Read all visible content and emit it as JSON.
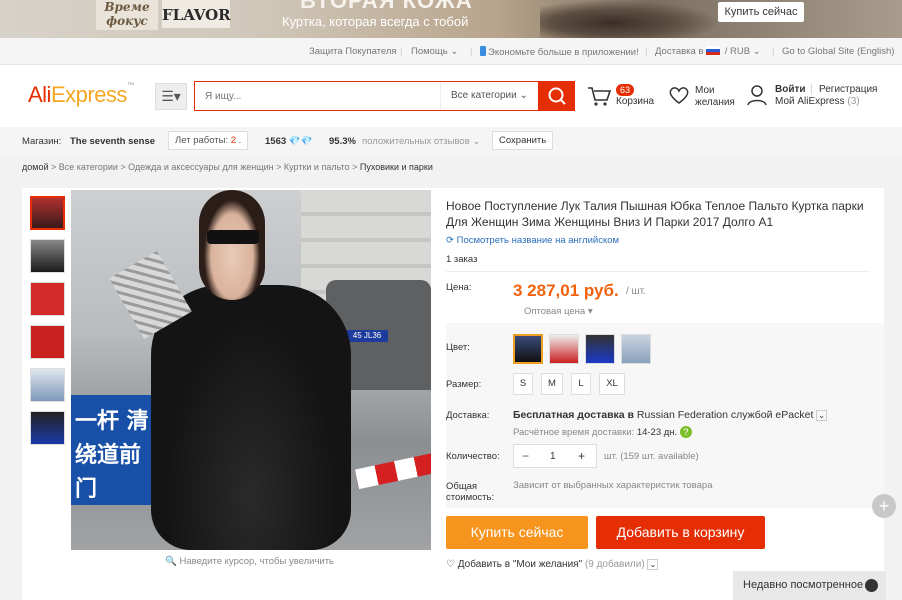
{
  "banner": {
    "brand_line1": "Време",
    "brand_line2": "фокус",
    "flavor": "FLAVOR",
    "headline": "ВТОРАЯ КОЖА",
    "subline": "Куртка, которая всегда с тобой",
    "buy_button": "Купить сейчас"
  },
  "topbar": {
    "buyer_protection": "Защита Покупателя",
    "help": "Помощь",
    "app_savings": "Экономьте больше в приложении!",
    "ship_to": "Доставка в",
    "currency": "RUB",
    "global_site": "Go to Global Site (English)"
  },
  "header": {
    "logo_main": "Ali",
    "logo_accent": "Express",
    "search_placeholder": "Я ищу...",
    "category_select": "Все категории",
    "cart_count": "63",
    "cart_label": "Корзина",
    "wishlist_line1": "Мои",
    "wishlist_line2": "желания",
    "login": "Войти",
    "register": "Регистрация",
    "my_aliexpress": "Мой AliExpress",
    "my_aliexpress_count": "(3)"
  },
  "store": {
    "label": "Магазин:",
    "name": "The seventh sense",
    "years_label": "Лет работы:",
    "years_value": "2",
    "rating_points": "1563",
    "positive_pct": "95.3%",
    "positive_label": "положительных отзывов",
    "save_button": "Сохранить"
  },
  "breadcrumbs": [
    "домой",
    "Все категории",
    "Одежда и аксессуары для женщин",
    "Куртки и пальто",
    "Пуховики и парки"
  ],
  "gallery": {
    "zoom_hint": "Наведите курсор, чтобы увеличить",
    "plate": "45 JL36",
    "sign_text": "一杆 清绕道前门"
  },
  "product": {
    "title": "Новое Поступление Лук Талия Пышная Юбка Теплое Пальто Куртка парки Для Женщин Зима Женщины Вниз И Парки 2017 Долго А1",
    "translate_link": "Посмотреть название на английском",
    "orders": "1 заказ",
    "price_label": "Цена:",
    "price": "3 287,01 руб.",
    "price_unit": "/ шт.",
    "wholesale": "Оптовая цена",
    "color_label": "Цвет:",
    "size_label": "Размер:",
    "sizes": [
      "S",
      "M",
      "L",
      "XL"
    ],
    "shipping_label": "Доставка:",
    "shipping_free": "Бесплатная доставка в",
    "shipping_country": "Russian Federation",
    "shipping_via": "службой ePacket",
    "delivery_time_label": "Расчётное время доставки:",
    "delivery_time": "14-23 дн.",
    "qty_label": "Количество:",
    "qty_value": "1",
    "qty_available": "шт. (159 шт. available)",
    "total_label_1": "Общая",
    "total_label_2": "стоимость:",
    "total_value": "Зависит от выбранных характеристик товара",
    "buy_now": "Купить сейчас",
    "add_to_cart": "Добавить в корзину",
    "wishlist_add": "Добавить в \"Мои желания\"",
    "wishlist_count": "(9 добавили)"
  },
  "recently_viewed": "Недавно посмотренное",
  "colors": {
    "accent": "#e62e04",
    "price": "#f0620d",
    "buy": "#f7941d",
    "link": "#2a6ebb"
  }
}
